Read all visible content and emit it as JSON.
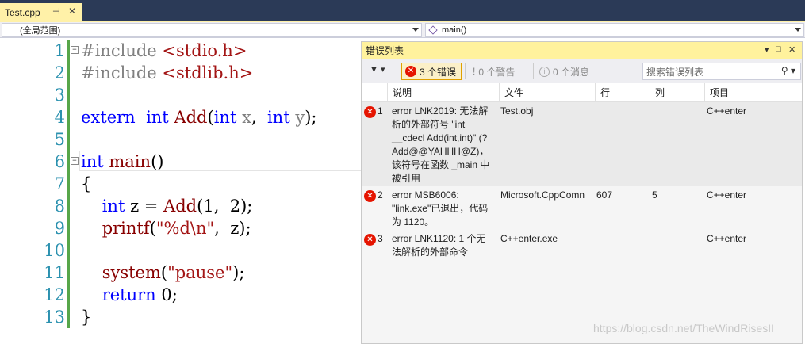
{
  "tab": {
    "title": "Test.cpp",
    "pin": "⊣",
    "close": "✕"
  },
  "navbar": {
    "scope": "(全局范围)",
    "function": "main()"
  },
  "editor": {
    "line_numbers": [
      "1",
      "2",
      "3",
      "4",
      "5",
      "6",
      "7",
      "8",
      "9",
      "10",
      "11",
      "12",
      "13"
    ],
    "code": [
      [
        [
          "pp",
          "#include "
        ],
        [
          "inc",
          "<stdio.h>"
        ]
      ],
      [
        [
          "pp",
          "#include "
        ],
        [
          "inc",
          "<stdlib.h>"
        ]
      ],
      [],
      [
        [
          "kw",
          "extern"
        ],
        [
          "",
          "  "
        ],
        [
          "kw",
          "int"
        ],
        [
          "",
          " "
        ],
        [
          "fn",
          "Add"
        ],
        [
          "",
          "("
        ],
        [
          "kw",
          "int"
        ],
        [
          "",
          " "
        ],
        [
          "prm",
          "x"
        ],
        [
          "",
          ",  "
        ],
        [
          "kw",
          "int"
        ],
        [
          "",
          " "
        ],
        [
          "prm",
          "y"
        ],
        [
          "",
          ");"
        ]
      ],
      [],
      [
        [
          "kw",
          "int"
        ],
        [
          "",
          " "
        ],
        [
          "fn",
          "main"
        ],
        [
          "",
          "()"
        ]
      ],
      [
        [
          "",
          "{"
        ]
      ],
      [
        [
          "",
          "    "
        ],
        [
          "kw",
          "int"
        ],
        [
          "",
          " z = "
        ],
        [
          "fn",
          "Add"
        ],
        [
          "",
          "(1,  2);"
        ]
      ],
      [
        [
          "",
          "    "
        ],
        [
          "fn",
          "printf"
        ],
        [
          "",
          "("
        ],
        [
          "str",
          "\"%d\\n\""
        ],
        [
          "",
          ",  z);"
        ]
      ],
      [],
      [
        [
          "",
          "    "
        ],
        [
          "fn",
          "system"
        ],
        [
          "",
          "("
        ],
        [
          "str",
          "\"pause\""
        ],
        [
          "",
          ");"
        ]
      ],
      [
        [
          "",
          "    "
        ],
        [
          "kw",
          "return"
        ],
        [
          "",
          " 0;"
        ]
      ],
      [
        [
          "",
          "}"
        ]
      ]
    ]
  },
  "error_list": {
    "title": "错误列表",
    "title_buttons": {
      "dropdown": "▾",
      "maximize": "□",
      "close": "✕"
    },
    "filter_label": "▼ ▾",
    "errors_label": "3 个错误",
    "warnings_label": "0 个警告",
    "messages_label": "0 个消息",
    "search_placeholder": "搜索错误列表",
    "columns": [
      "说明",
      "文件",
      "行",
      "列",
      "项目"
    ],
    "rows": [
      {
        "num": "1",
        "desc_lines": [
          "error LNK2019: 无法解",
          "析的外部符号 \"int",
          "__cdecl Add(int,int)\" (?",
          "Add@@YAHHH@Z)，",
          "该符号在函数 _main 中",
          "被引用"
        ],
        "file": "Test.obj",
        "line": "",
        "col": "",
        "project": "C++enter"
      },
      {
        "num": "2",
        "desc_lines": [
          "error MSB6006:",
          "\"link.exe\"已退出，代码",
          "为 1120。"
        ],
        "file": "Microsoft.CppComn",
        "line": "607",
        "col": "5",
        "project": "C++enter"
      },
      {
        "num": "3",
        "desc_lines": [
          "error LNK1120: 1 个无",
          "法解析的外部命令"
        ],
        "file": "C++enter.exe",
        "line": "",
        "col": "",
        "project": "C++enter"
      }
    ]
  },
  "watermark": "https://blog.csdn.net/TheWindRisesII",
  "colors": {
    "keyword": "#0000ff",
    "error": "#e51400",
    "tab_active": "#fff1a8"
  }
}
